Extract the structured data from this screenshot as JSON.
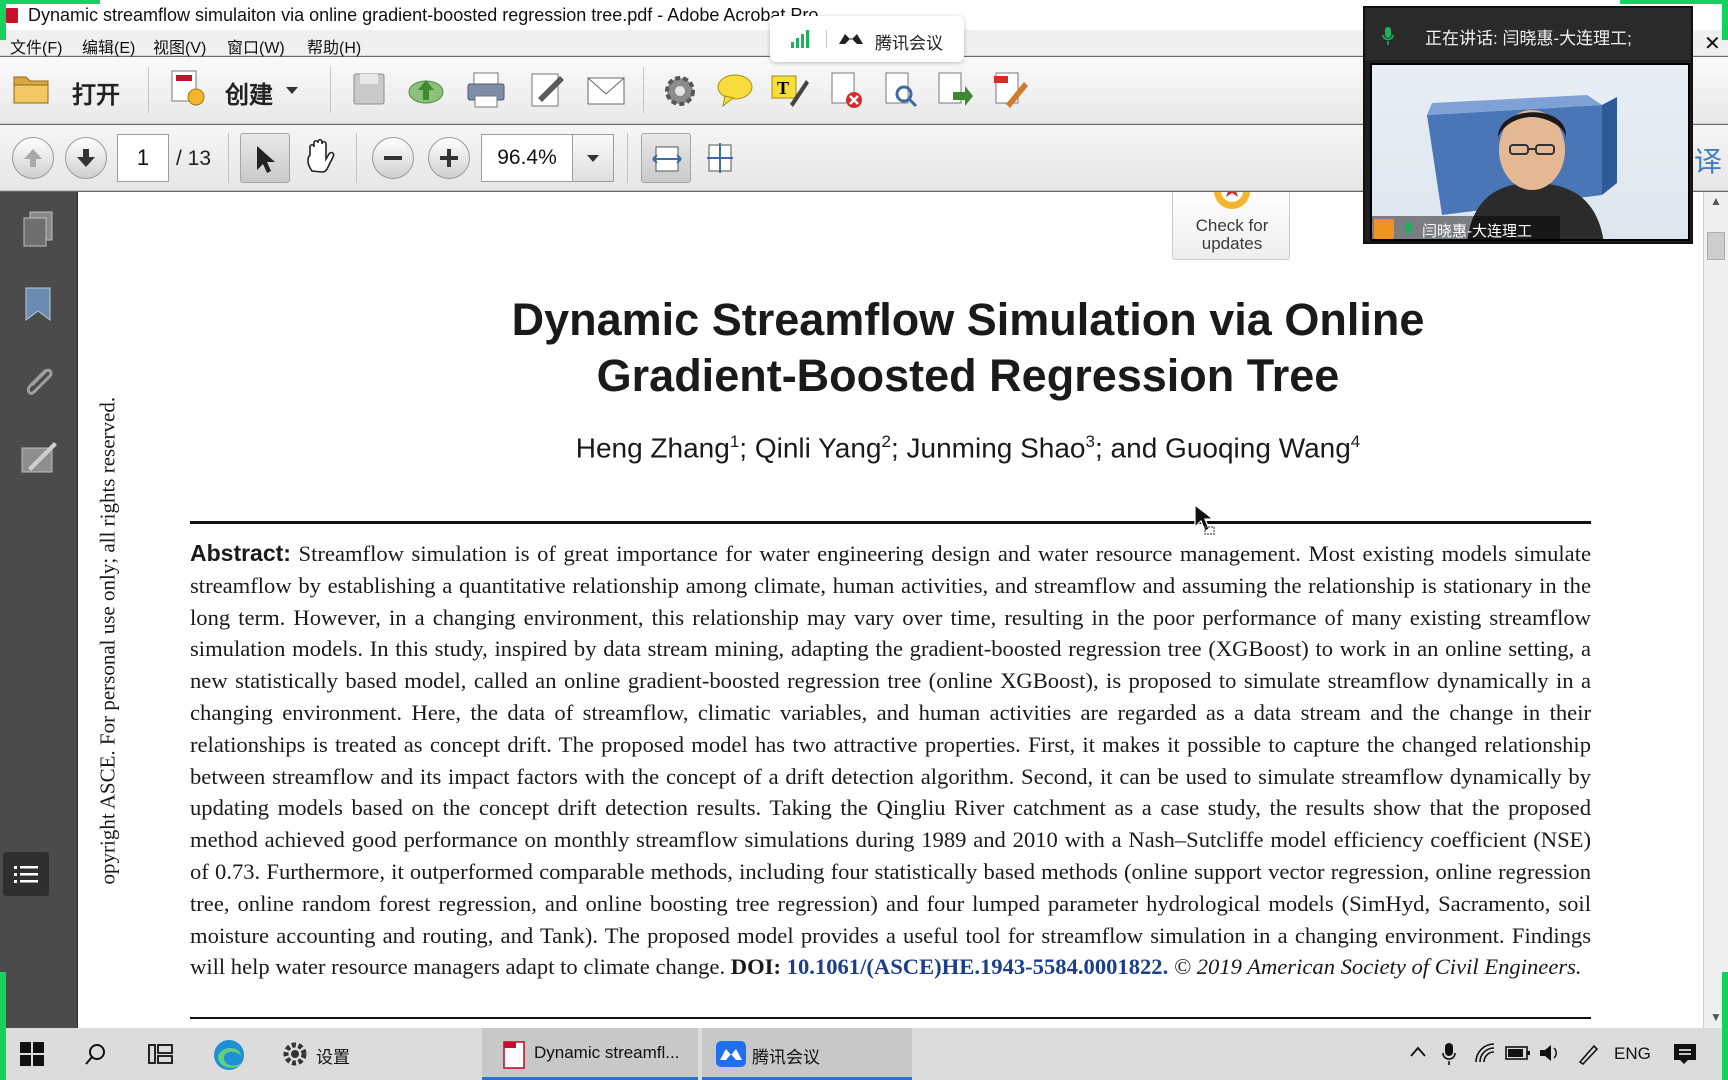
{
  "window": {
    "title": "Dynamic streamflow simulaiton via online gradient-boosted regression tree.pdf - Adobe Acrobat Pro"
  },
  "menu": [
    "文件(F)",
    "编辑(E)",
    "视图(V)",
    "窗口(W)",
    "帮助(H)"
  ],
  "meeting_pill": {
    "label": "腾讯会议"
  },
  "toolbar1": {
    "open_label": "打开",
    "create_label": "创建"
  },
  "toolbar2": {
    "page_current": "1",
    "page_total": "/ 13",
    "zoom": "96.4%"
  },
  "video_panel": {
    "speaking": "正在讲话: 闫晓惠-大连理工;",
    "participant_name": "闫晓惠-大连理工"
  },
  "side_glyph": "译",
  "document": {
    "check_updates": "Check for updates",
    "title_line1": "Dynamic Streamflow Simulation via Online",
    "title_line2": "Gradient-Boosted Regression Tree",
    "authors": [
      {
        "name": "Heng Zhang",
        "sup": "1",
        "sep": "; "
      },
      {
        "name": "Qinli Yang",
        "sup": "2",
        "sep": "; "
      },
      {
        "name": "Junming Shao",
        "sup": "3",
        "sep": "; and "
      },
      {
        "name": "Guoqing Wang",
        "sup": "4",
        "sep": ""
      }
    ],
    "abstract_label": "Abstract:",
    "abstract_text": "Streamflow simulation is of great importance for water engineering design and water resource management. Most existing models simulate streamflow by establishing a quantitative relationship among climate, human activities, and streamflow and assuming the relationship is stationary in the long term. However, in a changing environment, this relationship may vary over time, resulting in the poor performance of many existing streamflow simulation models. In this study, inspired by data stream mining, adapting the gradient-boosted regression tree (XGBoost) to work in an online setting, a new statistically based model, called an online gradient-boosted regression tree (online XGBoost), is proposed to simulate streamflow dynamically in a changing environment. Here, the data of streamflow, climatic variables, and human activities are regarded as a data stream and the change in their relationships is treated as concept drift. The proposed model has two attractive properties. First, it makes it possible to capture the changed relationship between streamflow and its impact factors with the concept of a drift detection algorithm. Second, it can be used to simulate streamflow dynamically by updating models based on the concept drift detection results. Taking the Qingliu River catchment as a case study, the results show that the proposed method achieved good performance on monthly streamflow simulations during 1989 and 2010 with a Nash–Sutcliffe model efficiency coefficient (NSE) of 0.73. Furthermore, it outperformed comparable methods, including four statistically based methods (online support vector regression, online regression tree, online random forest regression, and online boosting tree regression) and four lumped parameter hydrological models (SimHyd, Sacramento, soil moisture accounting and routing, and Tank). The proposed model provides a useful tool for streamflow simulation in a changing environment. Findings will help water resource managers adapt to climate change.",
    "doi_label": "DOI:",
    "doi": "10.1061/(ASCE)HE.1943-5584.0001822.",
    "copyright": "© 2019 American Society of Civil Engineers.",
    "side_note": "opyright ASCE. For personal use only; all rights reserved."
  },
  "taskbar": {
    "settings_label": "设置",
    "acrobat_label": "Dynamic streamfl...",
    "meeting_label": "腾讯会议",
    "lang": "ENG"
  },
  "colors": {
    "accent_blue": "#2b73c9",
    "doi_blue": "#1b3f8f",
    "recording_green": "#18d05e",
    "pdf_red": "#c8102e"
  },
  "icons": [
    "open-folder-icon",
    "create-pdf-icon",
    "save-icon",
    "cloud-upload-icon",
    "print-icon",
    "edit-icon",
    "email-icon",
    "gear-icon",
    "comment-icon",
    "typewriter-icon",
    "delete-icon",
    "search-doc-icon",
    "export-icon",
    "sign-icon",
    "page-up-icon",
    "page-down-icon",
    "select-cursor-icon",
    "hand-icon",
    "zoom-out-icon",
    "zoom-in-icon",
    "fit-width-icon",
    "fit-page-icon",
    "pages-icon",
    "bookmark-icon",
    "attachment-icon",
    "signature-icon",
    "toc-icon",
    "windows-start-icon",
    "search-icon",
    "task-view-icon",
    "edge-icon"
  ]
}
